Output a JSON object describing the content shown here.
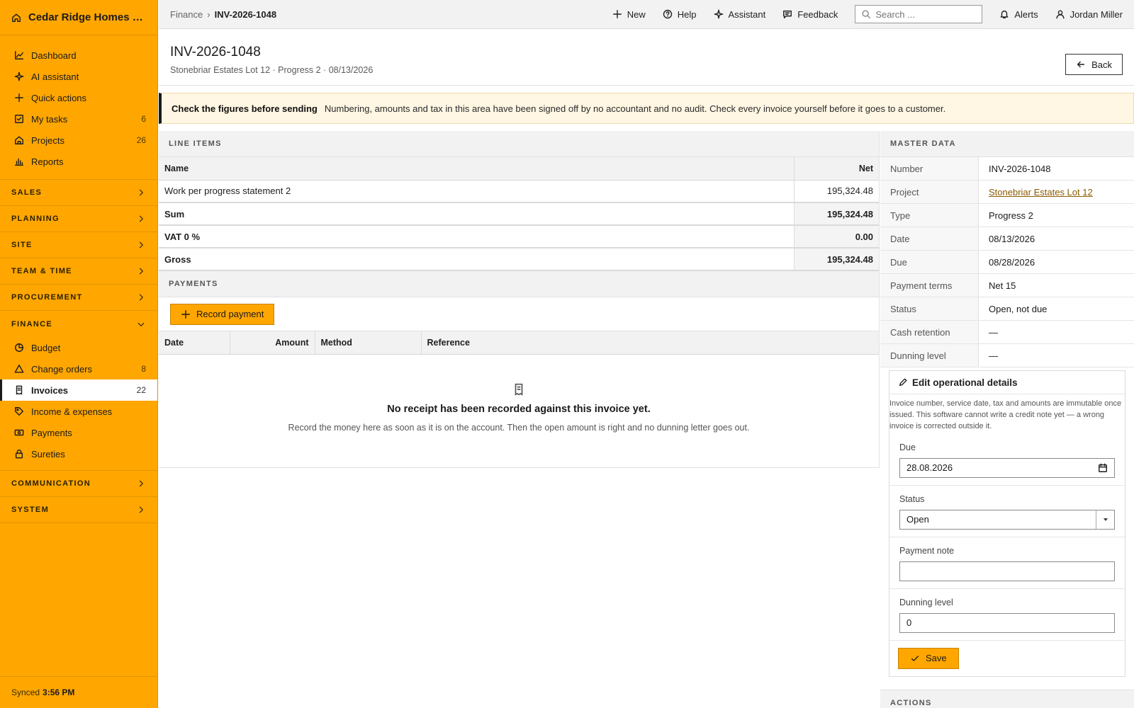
{
  "brand": {
    "name": "Cedar Ridge Homes L...",
    "icon": "home-icon"
  },
  "nav_top": [
    {
      "label": "Dashboard",
      "icon": "chart-line-icon",
      "count": ""
    },
    {
      "label": "AI assistant",
      "icon": "sparkle-icon",
      "count": ""
    },
    {
      "label": "Quick actions",
      "icon": "plus-icon",
      "count": ""
    },
    {
      "label": "My tasks",
      "icon": "checkbox-icon",
      "count": "6"
    },
    {
      "label": "Projects",
      "icon": "house-icon",
      "count": "26"
    },
    {
      "label": "Reports",
      "icon": "bar-chart-icon",
      "count": ""
    }
  ],
  "sections": {
    "sales": "SALES",
    "planning": "PLANNING",
    "site": "SITE",
    "team_time": "TEAM & TIME",
    "procurement": "PROCUREMENT",
    "finance": "FINANCE",
    "communication": "COMMUNICATION",
    "system": "SYSTEM"
  },
  "finance_items": [
    {
      "label": "Budget",
      "icon": "pie-icon",
      "count": ""
    },
    {
      "label": "Change orders",
      "icon": "triangle-icon",
      "count": "8"
    },
    {
      "label": "Invoices",
      "icon": "receipt-icon",
      "count": "22",
      "active": true
    },
    {
      "label": "Income & expenses",
      "icon": "tag-icon",
      "count": ""
    },
    {
      "label": "Payments",
      "icon": "banknote-icon",
      "count": ""
    },
    {
      "label": "Sureties",
      "icon": "lock-icon",
      "count": ""
    }
  ],
  "sync": {
    "label": "Synced",
    "time": "3:56 PM"
  },
  "topbar": {
    "crumb_parent": "Finance",
    "crumb_current": "INV-2026-1048",
    "new": "New",
    "help": "Help",
    "assistant": "Assistant",
    "feedback": "Feedback",
    "search_placeholder": "Search ...",
    "alerts": "Alerts",
    "user": "Jordan Miller"
  },
  "page": {
    "title": "INV-2026-1048",
    "subtitle": "Stonebriar Estates Lot 12 · Progress 2 · 08/13/2026",
    "back": "Back"
  },
  "notice": {
    "title": "Check the figures before sending",
    "text": "Numbering, amounts and tax in this area have been signed off by no accountant and no audit. Check every invoice yourself before it goes to a customer."
  },
  "line_items": {
    "heading": "LINE ITEMS",
    "col_name": "Name",
    "col_net": "Net",
    "rows": [
      {
        "name": "Work per progress statement 2",
        "net": "195,324.48"
      }
    ],
    "sum_label": "Sum",
    "sum_value": "195,324.48",
    "vat_label": "VAT 0 %",
    "vat_value": "0.00",
    "gross_label": "Gross",
    "gross_value": "195,324.48"
  },
  "payments": {
    "heading": "PAYMENTS",
    "record_button": "Record payment",
    "cols": {
      "date": "Date",
      "amount": "Amount",
      "method": "Method",
      "reference": "Reference"
    },
    "empty_title": "No receipt has been recorded against this invoice yet.",
    "empty_text": "Record the money here as soon as it is on the account. Then the open amount is right and no dunning letter goes out."
  },
  "master": {
    "heading": "MASTER DATA",
    "rows": [
      {
        "k": "Number",
        "v": "INV-2026-1048"
      },
      {
        "k": "Project",
        "v": "Stonebriar Estates Lot 12",
        "link": true
      },
      {
        "k": "Type",
        "v": "Progress 2"
      },
      {
        "k": "Date",
        "v": "08/13/2026"
      },
      {
        "k": "Due",
        "v": "08/28/2026"
      },
      {
        "k": "Payment terms",
        "v": "Net 15"
      },
      {
        "k": "Status",
        "v": "Open, not due"
      },
      {
        "k": "Cash retention",
        "v": "—"
      },
      {
        "k": "Dunning level",
        "v": "—"
      }
    ]
  },
  "edit": {
    "title": "Edit operational details",
    "note": "Invoice number, service date, tax and amounts are immutable once issued. This software cannot write a credit note yet — a wrong invoice is corrected outside it.",
    "due_label": "Due",
    "due_value": "28.08.2026",
    "status_label": "Status",
    "status_value": "Open",
    "note_label": "Payment note",
    "note_value": "",
    "dunning_label": "Dunning level",
    "dunning_value": "0",
    "save": "Save"
  },
  "actions_heading": "ACTIONS"
}
